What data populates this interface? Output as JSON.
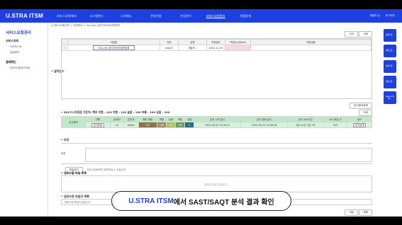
{
  "app": {
    "logo": "U.STRA ITSM"
  },
  "nav": {
    "items": [
      "서비스요청/배포",
      "시스템관리",
      "나의메뉴",
      "운영지원",
      "변경관리",
      "서비스요청관리",
      "현황통계"
    ],
    "active_index": 5,
    "user": "개발자 님",
    "logout": "로그아웃"
  },
  "sidebar": {
    "title": "서비스요청관리",
    "groups": [
      {
        "label": "서비스처리",
        "items": [
          "처리리스트",
          "일괄배포"
        ]
      },
      {
        "label": "결재확인",
        "items": [
          "담당자/결재선조회"
        ]
      }
    ]
  },
  "breadcrumb": "서비스요청관리 > 변경처리 > Security 점거/보이저내역등록",
  "top_buttons": {
    "new": "신규",
    "delete": "삭제"
  },
  "work_table": {
    "section_label": "실작업수",
    "headers": [
      "",
      "작업명",
      "차반",
      "성명",
      "작업일자",
      "*작업시간(M/H)",
      "작업내용"
    ],
    "row": {
      "name": "Security 점거/보이저내역등록",
      "seq": "test07",
      "person": "개발자",
      "date": "2022-11-09",
      "hours": "",
      "content": ""
    }
  },
  "sast": {
    "title": "SAST(1차점검 기준치) 해무 위험 : 100 위험 : 100 높음 : 100 보통 : 100 낮음 : 100",
    "buttons": {
      "register": "분석결과등록",
      "status": "조회"
    },
    "headers": [
      "분석결과",
      "진행",
      "분석ID",
      "분석자",
      "해무 위험",
      "위험",
      "높음",
      "보통",
      "낮음",
      "분석 시작 일시",
      "분석 종료 일시",
      "분석 소요시간",
      "소스 파일 수",
      "링크"
    ],
    "row": {
      "label": "분석결과",
      "status": "분석완료",
      "id": "14",
      "analyst": "admin",
      "crit": "255",
      "high": "106",
      "medium": "15",
      "normal": "159",
      "low": "0",
      "start": "2022-09-22 15:35:21",
      "end": "2022-09-22 15:36:28",
      "duration": "0일 0시간 1분 7초",
      "files": "323",
      "link": "분석상세"
    }
  },
  "opinion": {
    "label": "의견",
    "sub_label": "의견"
  },
  "attach": {
    "button": "파일찾기",
    "hint": "최대 20MB까지 첨부하실 수 있습니다.",
    "list_label": "업로드할 파일 목록",
    "empty": "첨부된 파일이 없습니다.",
    "uploaded_label": "업로드된 파일의 목록",
    "uploaded_empty": "업로드된 파일이 없습니다."
  },
  "bottom_buttons": {
    "save": "저장",
    "list": "목록"
  },
  "right_tabs": [
    "운영 정...",
    "배포 정...",
    "변경 정...",
    "점검 정...",
    "Security 정..."
  ],
  "caption": {
    "highlight": "U.STRA ITSM",
    "rest": "에서 SAST/SAQT 분석 결과 확인"
  }
}
